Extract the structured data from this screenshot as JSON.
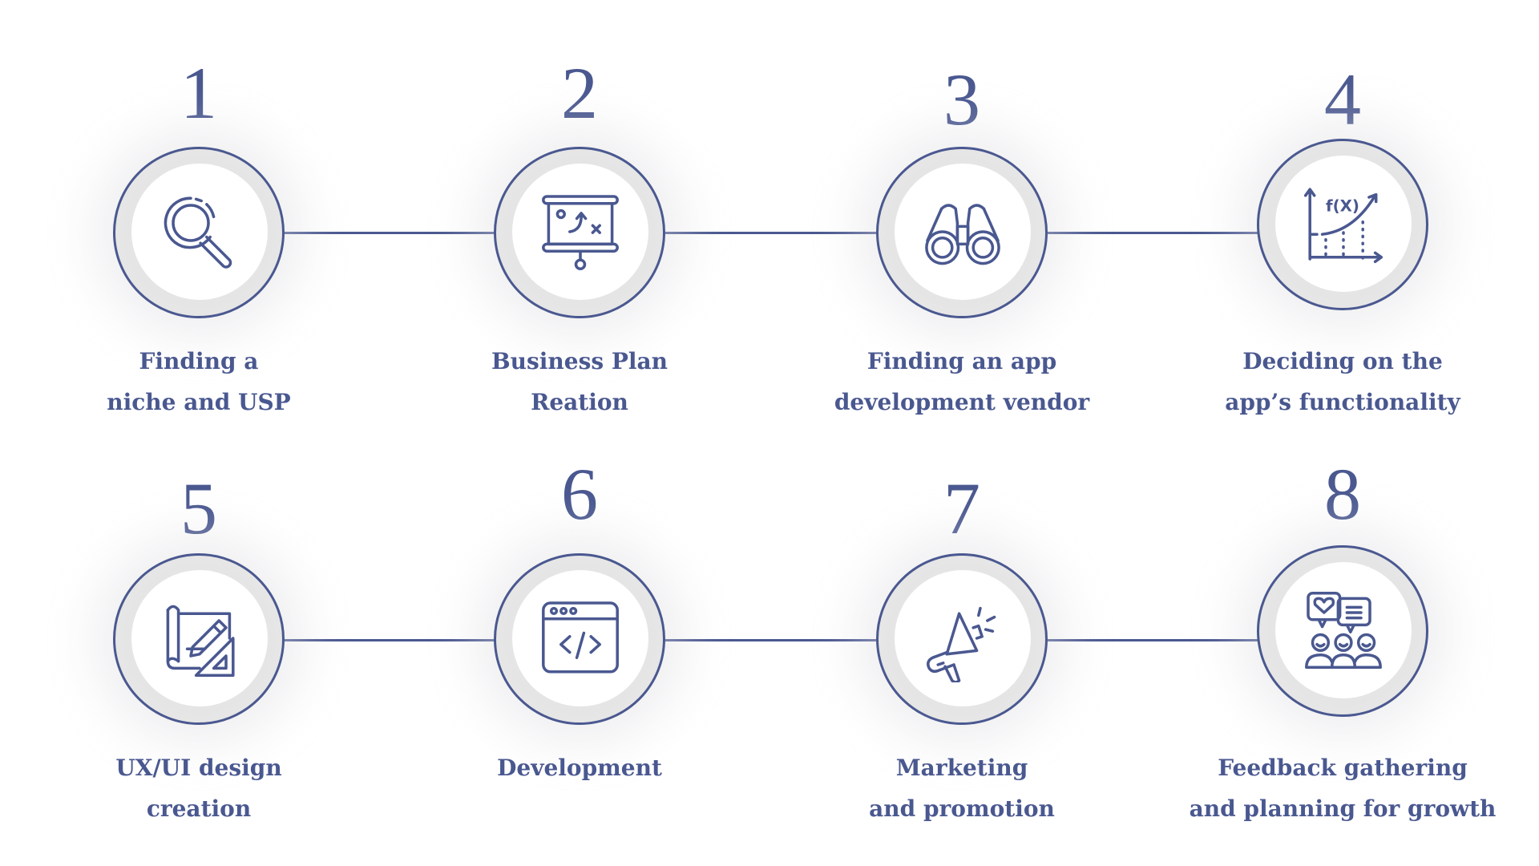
{
  "colors": {
    "accent": "#4a5890",
    "ring_fill": "#e4e4e4",
    "background": "#ffffff"
  },
  "steps": [
    {
      "number": "1",
      "icon": "magnifier-icon",
      "label_line1": "Finding a",
      "label_line2": "niche and USP"
    },
    {
      "number": "2",
      "icon": "presentation-board-icon",
      "label_line1": "Business Plan",
      "label_line2": "Reation"
    },
    {
      "number": "3",
      "icon": "binoculars-icon",
      "label_line1": "Finding an app",
      "label_line2": "development vendor"
    },
    {
      "number": "4",
      "icon": "function-graph-icon",
      "label_line1": "Deciding on the",
      "label_line2": "app’s functionality"
    },
    {
      "number": "5",
      "icon": "design-blueprint-icon",
      "label_line1": "UX/UI design",
      "label_line2": "creation"
    },
    {
      "number": "6",
      "icon": "code-window-icon",
      "label_line1": "Development",
      "label_line2": ""
    },
    {
      "number": "7",
      "icon": "megaphone-icon",
      "label_line1": "Marketing",
      "label_line2": "and promotion"
    },
    {
      "number": "8",
      "icon": "feedback-group-icon",
      "label_line1": "Feedback gathering",
      "label_line2": "and planning for growth"
    }
  ],
  "icon_text": {
    "fx": "f(X)"
  }
}
